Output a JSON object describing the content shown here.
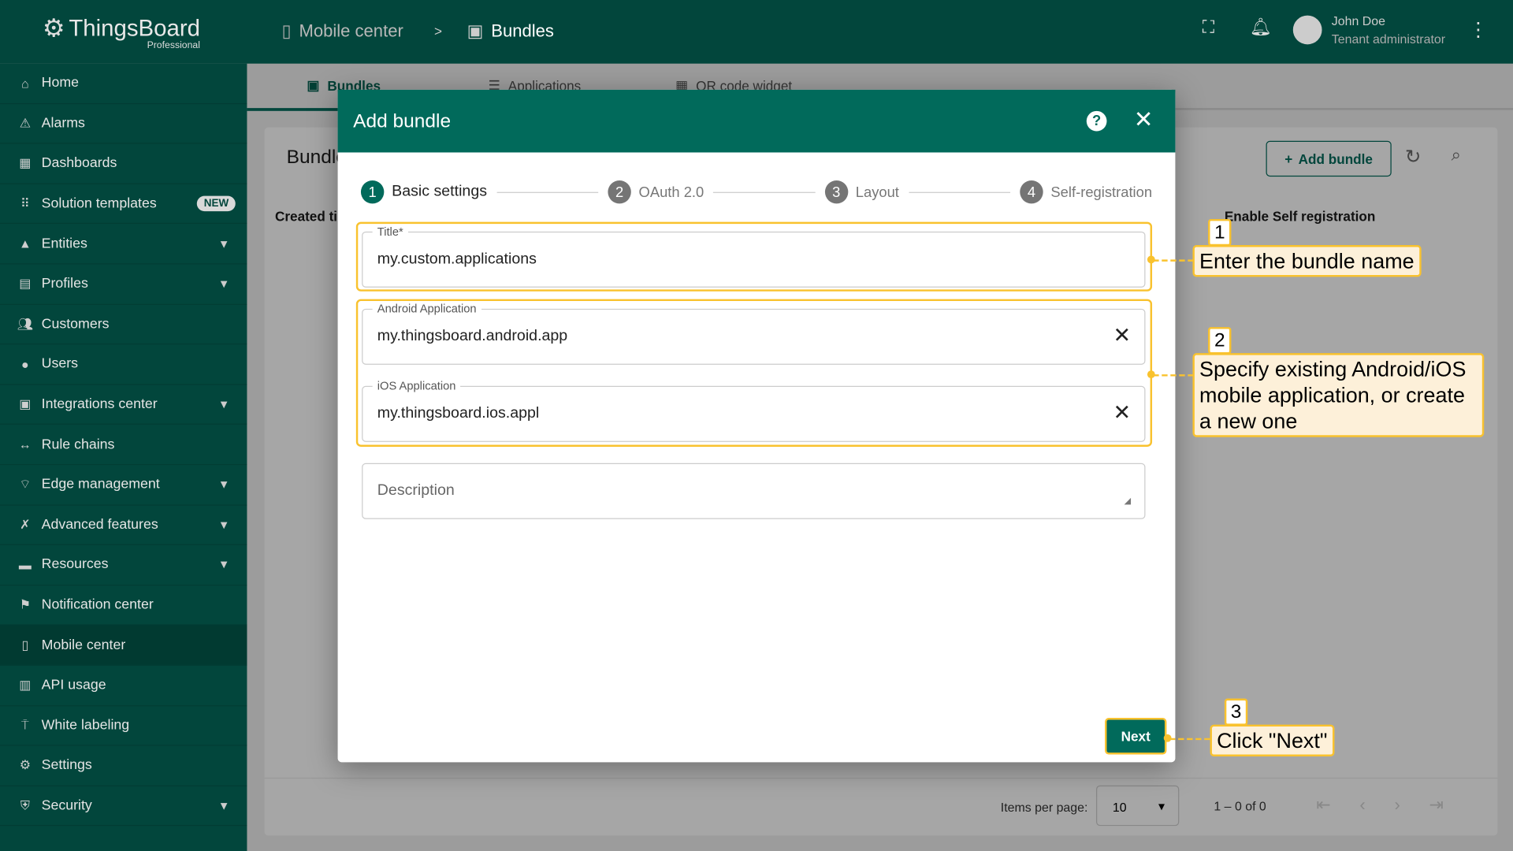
{
  "header": {
    "logo": "ThingsBoard",
    "edition": "Professional",
    "breadcrumb": [
      "Mobile center",
      "Bundles"
    ],
    "separator": ">",
    "user_name": "John Doe",
    "user_role": "Tenant administrator"
  },
  "sidebar": {
    "items": [
      {
        "label": "Home",
        "icon": "home-icon"
      },
      {
        "label": "Alarms",
        "icon": "alarm-icon"
      },
      {
        "label": "Dashboards",
        "icon": "dashboard-icon"
      },
      {
        "label": "Solution templates",
        "icon": "grid-icon",
        "badge": "NEW"
      },
      {
        "label": "Entities",
        "icon": "entities-icon",
        "expandable": true
      },
      {
        "label": "Profiles",
        "icon": "profiles-icon",
        "expandable": true
      },
      {
        "label": "Customers",
        "icon": "customers-icon"
      },
      {
        "label": "Users",
        "icon": "user-icon"
      },
      {
        "label": "Integrations center",
        "icon": "integrations-icon",
        "expandable": true
      },
      {
        "label": "Rule chains",
        "icon": "rule-chain-icon"
      },
      {
        "label": "Edge management",
        "icon": "edge-icon",
        "expandable": true
      },
      {
        "label": "Advanced features",
        "icon": "tools-icon",
        "expandable": true
      },
      {
        "label": "Resources",
        "icon": "folder-icon",
        "expandable": true
      },
      {
        "label": "Notification center",
        "icon": "notification-icon"
      },
      {
        "label": "Mobile center",
        "icon": "mobile-icon",
        "active": true
      },
      {
        "label": "API usage",
        "icon": "chart-icon"
      },
      {
        "label": "White labeling",
        "icon": "paint-icon"
      },
      {
        "label": "Settings",
        "icon": "gear-icon"
      },
      {
        "label": "Security",
        "icon": "shield-icon",
        "expandable": true
      }
    ]
  },
  "tabs": [
    "Bundles",
    "Applications",
    "QR code widget"
  ],
  "card": {
    "title": "Bundles",
    "col_created": "Created time",
    "col_self": "Enable Self registration",
    "add_label": "Add bundle",
    "items_per_page_label": "Items per page:",
    "items_per_page": "10",
    "range": "1 – 0 of 0"
  },
  "dialog": {
    "title": "Add bundle",
    "steps": [
      "Basic settings",
      "OAuth 2.0",
      "Layout",
      "Self-registration"
    ],
    "title_label": "Title*",
    "title_value": "my.custom.applications",
    "android_label": "Android Application",
    "android_value": "my.thingsboard.android.app",
    "ios_label": "iOS Application",
    "ios_value": "my.thingsboard.ios.appl",
    "description_placeholder": "Description",
    "next_label": "Next"
  },
  "callouts": [
    {
      "num": "1",
      "text": "Enter the bundle name"
    },
    {
      "num": "2",
      "text": "Specify existing Android/iOS mobile application, or create a new one"
    },
    {
      "num": "3",
      "text": "Click \"Next\""
    }
  ],
  "colors": {
    "primary": "#016a5b",
    "nav": "#02463c",
    "highlight": "#f9c22e"
  }
}
